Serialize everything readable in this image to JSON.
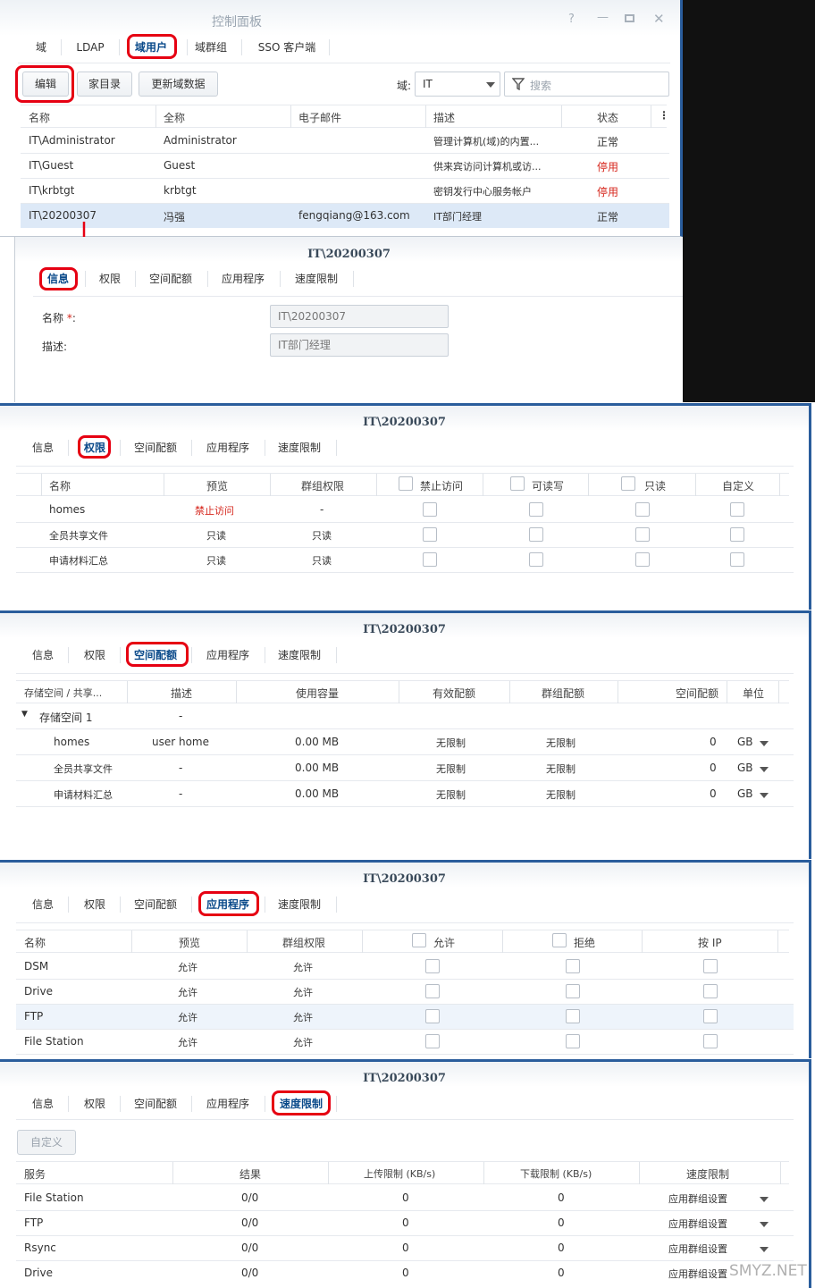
{
  "window": {
    "title": "控制面板"
  },
  "top_tabs": [
    "域",
    "LDAP",
    "域用户",
    "域群组",
    "SSO 客户端"
  ],
  "toolbar": {
    "edit": "编辑",
    "home_dir": "家目录",
    "update_domain": "更新域数据",
    "domain_label": "域:",
    "domain_value": "IT",
    "search_placeholder": "搜索"
  },
  "user_table": {
    "columns": [
      "名称",
      "全称",
      "电子邮件",
      "描述",
      "状态"
    ],
    "rows": [
      {
        "name": "IT\\Administrator",
        "full": "Administrator",
        "email": "",
        "desc": "管理计算机(域)的内置...",
        "status": "正常"
      },
      {
        "name": "IT\\Guest",
        "full": "Guest",
        "email": "",
        "desc": "供来宾访问计算机或访...",
        "status": "停用"
      },
      {
        "name": "IT\\krbtgt",
        "full": "krbtgt",
        "email": "",
        "desc": "密钥发行中心服务帐户",
        "status": "停用"
      },
      {
        "name": "IT\\20200307",
        "full": "冯强",
        "email": "fengqiang@163.com",
        "desc": "IT部门经理",
        "status": "正常"
      }
    ]
  },
  "dialog_title": "IT\\20200307",
  "dialog_tabs": [
    "信息",
    "权限",
    "空间配额",
    "应用程序",
    "速度限制"
  ],
  "info": {
    "name_label": "名称",
    "name_value": "IT\\20200307",
    "desc_label": "描述:",
    "desc_value": "IT部门经理"
  },
  "perm": {
    "columns": [
      "名称",
      "预览",
      "群组权限",
      "禁止访问",
      "可读写",
      "只读",
      "自定义"
    ],
    "rows": [
      {
        "name": "homes",
        "preview": "禁止访问",
        "group": "-"
      },
      {
        "name": "全员共享文件",
        "preview": "只读",
        "group": "只读"
      },
      {
        "name": "申请材料汇总",
        "preview": "只读",
        "group": "只读"
      }
    ]
  },
  "quota": {
    "columns": [
      "存储空间 / 共享...",
      "描述",
      "使用容量",
      "有效配额",
      "群组配额",
      "空间配额",
      "单位"
    ],
    "group_row": {
      "name": "存储空间 1",
      "desc": "-"
    },
    "rows": [
      {
        "name": "homes",
        "desc": "user home",
        "used": "0.00 MB",
        "effective": "无限制",
        "group": "无限制",
        "quota": "0",
        "unit": "GB"
      },
      {
        "name": "全员共享文件",
        "desc": "-",
        "used": "0.00 MB",
        "effective": "无限制",
        "group": "无限制",
        "quota": "0",
        "unit": "GB"
      },
      {
        "name": "申请材料汇总",
        "desc": "-",
        "used": "0.00 MB",
        "effective": "无限制",
        "group": "无限制",
        "quota": "0",
        "unit": "GB"
      }
    ]
  },
  "apps": {
    "columns": [
      "名称",
      "预览",
      "群组权限",
      "允许",
      "拒绝",
      "按 IP"
    ],
    "rows": [
      {
        "name": "DSM",
        "preview": "允许",
        "group": "允许"
      },
      {
        "name": "Drive",
        "preview": "允许",
        "group": "允许"
      },
      {
        "name": "FTP",
        "preview": "允许",
        "group": "允许"
      },
      {
        "name": "File Station",
        "preview": "允许",
        "group": "允许"
      }
    ]
  },
  "speed": {
    "custom_button": "自定义",
    "columns": [
      "服务",
      "结果",
      "上传限制 (KB/s)",
      "下载限制 (KB/s)",
      "速度限制"
    ],
    "rows": [
      {
        "service": "File Station",
        "result": "0/0",
        "up": "0",
        "down": "0",
        "limit": "应用群组设置"
      },
      {
        "service": "FTP",
        "result": "0/0",
        "up": "0",
        "down": "0",
        "limit": "应用群组设置"
      },
      {
        "service": "Rsync",
        "result": "0/0",
        "up": "0",
        "down": "0",
        "limit": "应用群组设置"
      },
      {
        "service": "Drive",
        "result": "0/0",
        "up": "0",
        "down": "0",
        "limit": "应用群组设置"
      }
    ]
  },
  "watermark": "SMYZ.NET",
  "colors": {
    "highlight": "#e60012",
    "selected_row": "#dde9f7",
    "disabled_text": "#d6261c"
  }
}
